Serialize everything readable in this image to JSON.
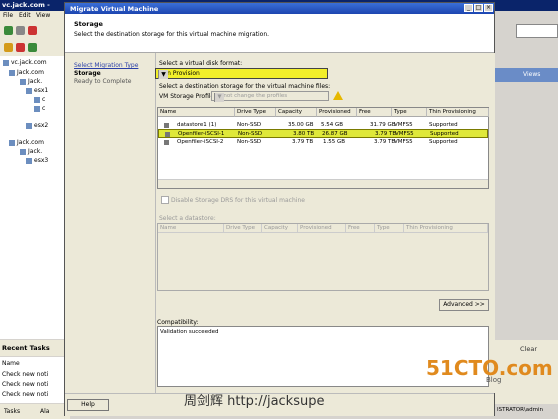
{
  "background": {
    "title": "vc.jack.com -",
    "menu": [
      "File",
      "Edit",
      "View"
    ],
    "tree": [
      "vc.jack.com",
      "Jack.com",
      "Jack.",
      "esx1",
      "c",
      "c",
      "esx2",
      "Jack.com",
      "Jack.",
      "esx3"
    ],
    "recent_tasks_title": "Recent Tasks",
    "recent_tasks_col": "Name",
    "tasks": [
      "Check new noti",
      "Check new noti",
      "Check new noti"
    ],
    "taskbar_label": "Tasks",
    "taskbar_label2": "Ala",
    "right_panel_label": "Views",
    "right_clear": "Clear",
    "right_status": "ISTRATOR\\admin"
  },
  "dialog": {
    "title": "Migrate Virtual Machine",
    "header_title": "Storage",
    "header_desc": "Select the destination storage for this virtual machine migration.",
    "nav": [
      {
        "label": "Select Migration Type",
        "state": "link"
      },
      {
        "label": "Storage",
        "state": "current"
      },
      {
        "label": "Ready to Complete",
        "state": "pending"
      }
    ],
    "disk_format_label": "Select a virtual disk format:",
    "disk_format_value": "Thin Provision",
    "dest_label": "Select a destination storage for the virtual machine files:",
    "profile_label": "VM Storage Profile:",
    "profile_value": "Do not change the profiles",
    "table": {
      "columns": [
        "Name",
        "Drive Type",
        "Capacity",
        "Provisioned",
        "Free",
        "Type",
        "Thin Provisioning"
      ],
      "rows": [
        {
          "name": "datastore1 (1)",
          "drive": "Non-SSD",
          "capacity": "35.00 GB",
          "provisioned": "5.54 GB",
          "free": "31.79 GB",
          "type": "VMFS5",
          "thin": "Supported",
          "selected": false
        },
        {
          "name": "Openfiler-iSCSI-1",
          "drive": "Non-SSD",
          "capacity": "3.80 TB",
          "provisioned": "26.87 GB",
          "free": "3.79 TB",
          "type": "VMFS5",
          "thin": "Supported",
          "selected": true
        },
        {
          "name": "Openfiler-iSCSI-2",
          "drive": "Non-SSD",
          "capacity": "3.79 TB",
          "provisioned": "1.55 GB",
          "free": "3.79 TB",
          "type": "VMFS5",
          "thin": "Supported",
          "selected": false
        }
      ]
    },
    "storage_drs_label": "Disable Storage DRS for this virtual machine",
    "select_datastore_label": "Select a datastore:",
    "table2_columns": [
      "Name",
      "Drive Type",
      "Capacity",
      "Provisioned",
      "Free",
      "Type",
      "Thin Provisioning"
    ],
    "advanced_button": "Advanced >>",
    "compat_label": "Compatibility:",
    "compat_value": "Validation succeeded",
    "help_button": "Help"
  },
  "watermark": {
    "site": "51CTO.com",
    "blog": "Blog",
    "author": "周剑辉 http://jacksupe"
  },
  "colors": {
    "highlight": "#dfe83a",
    "titlebar": "#1c45b0"
  }
}
